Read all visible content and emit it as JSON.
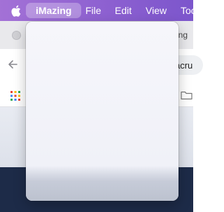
{
  "menubar": {
    "apple_icon": "apple-logo-icon",
    "app_name": "iMazing",
    "items": [
      "File",
      "Edit",
      "View",
      "Too"
    ],
    "background_color": "#8b5fd0",
    "highlight_color": "#a97fe0"
  },
  "browser": {
    "tab_text": "king",
    "address_text": "acru",
    "icons": [
      "back-arrow-icon",
      "apps-grid-icon",
      "folder-icon"
    ]
  },
  "dropdown": {
    "state": "open",
    "items": []
  }
}
